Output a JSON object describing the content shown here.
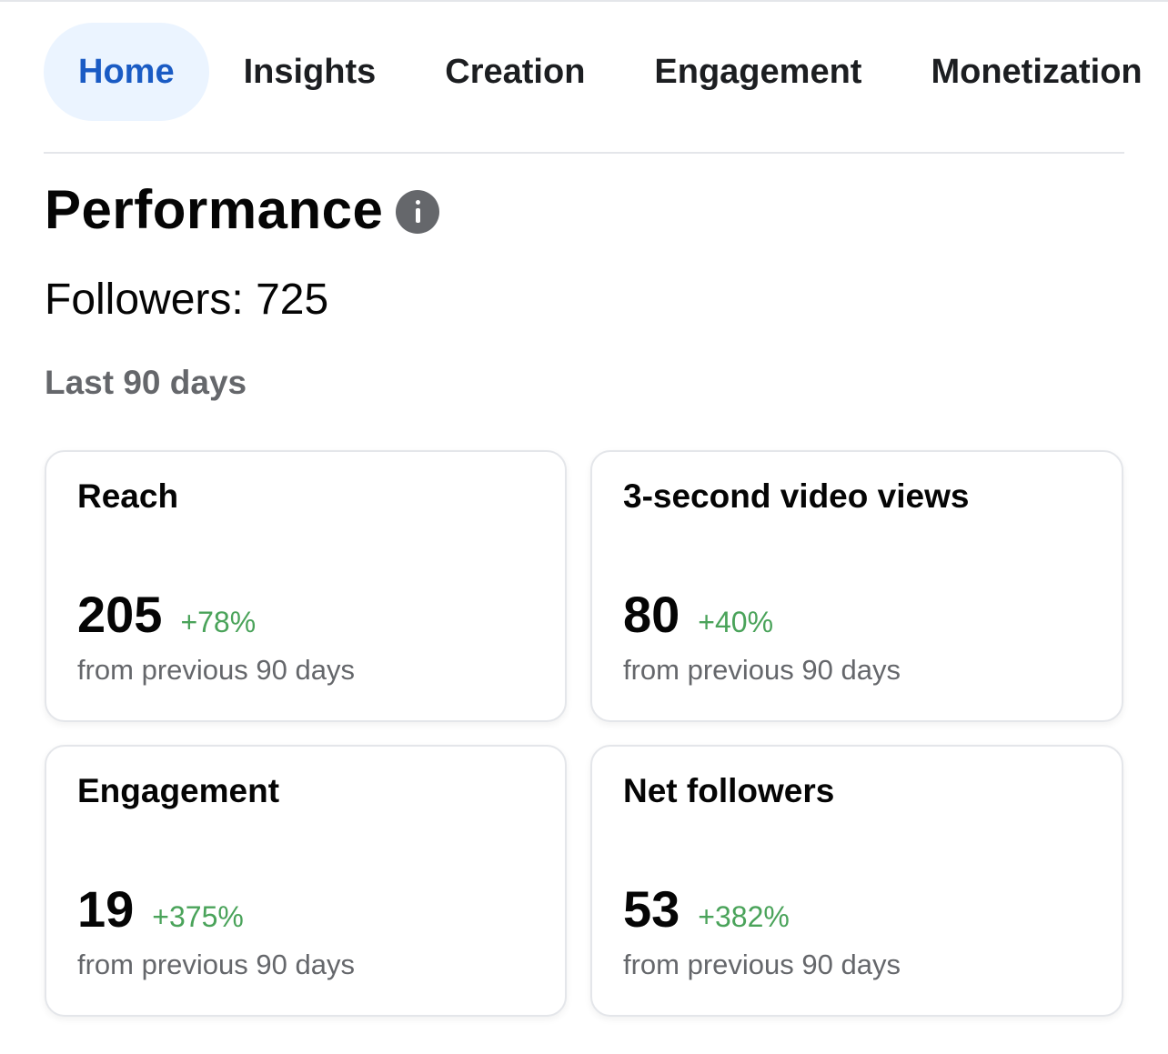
{
  "tabs": [
    {
      "label": "Home",
      "active": true
    },
    {
      "label": "Insights",
      "active": false
    },
    {
      "label": "Creation",
      "active": false
    },
    {
      "label": "Engagement",
      "active": false
    },
    {
      "label": "Monetization",
      "active": false
    }
  ],
  "performance": {
    "title": "Performance",
    "followers_label": "Followers:",
    "followers_value": "725",
    "period": "Last 90 days"
  },
  "cards": [
    {
      "title": "Reach",
      "value": "205",
      "change": "+78%",
      "caption": "from previous 90 days"
    },
    {
      "title": "3-second video views",
      "value": "80",
      "change": "+40%",
      "caption": "from previous 90 days"
    },
    {
      "title": "Engagement",
      "value": "19",
      "change": "+375%",
      "caption": "from previous 90 days"
    },
    {
      "title": "Net followers",
      "value": "53",
      "change": "+382%",
      "caption": "from previous 90 days"
    }
  ],
  "colors": {
    "active_tab_bg": "#ebf4ff",
    "active_tab_text": "#1a5bc4",
    "positive_change": "#4aa35a",
    "secondary_text": "#65676b",
    "icon_gray": "#65676b"
  },
  "icons": {
    "performance_info": "info-icon"
  }
}
